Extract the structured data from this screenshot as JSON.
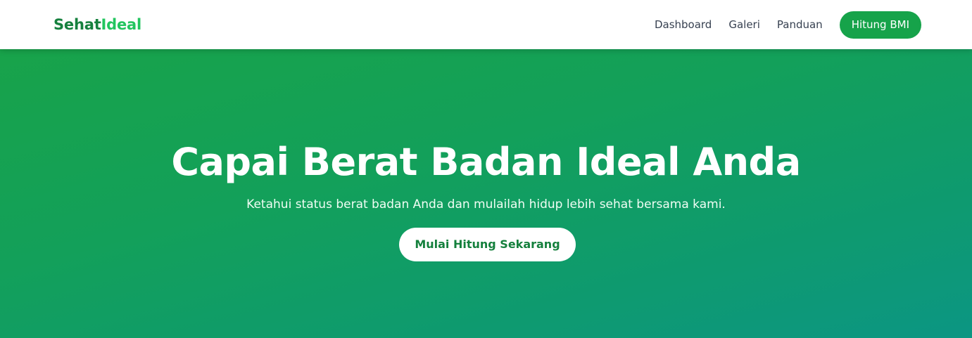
{
  "brand": {
    "part1": "Sehat",
    "part2": "Ideal"
  },
  "nav": {
    "links": [
      "Dashboard",
      "Galeri",
      "Panduan"
    ],
    "cta_label": "Hitung BMI"
  },
  "hero": {
    "title": "Capai Berat Badan Ideal Anda",
    "subtitle": "Ketahui status berat badan Anda dan mulailah hidup lebih sehat bersama kami.",
    "cta_label": "Mulai Hitung Sekarang"
  },
  "colors": {
    "brand_dark": "#15803d",
    "brand_light": "#22c55e",
    "primary": "#16a34a",
    "hero_gradient_start": "#18a34a",
    "hero_gradient_end": "#0c9683"
  }
}
